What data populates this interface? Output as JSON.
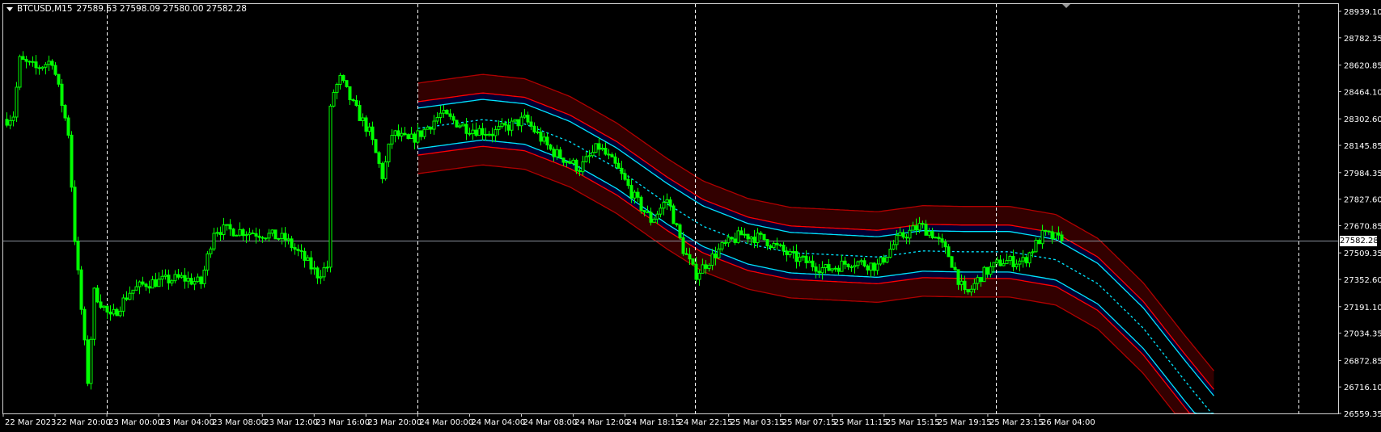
{
  "header": {
    "symbol": "BTCUSD,M15",
    "ohlc": "27589.63 27598.09 27580.00 27582.28",
    "menu_icon": "triangle-down-icon"
  },
  "current_price": "27582.28",
  "colors": {
    "background": "#000000",
    "candle": "#00ff00",
    "band_outer": "#b00000",
    "band_inner_red": "#ff0000",
    "band_fill_red": "#320000",
    "band_fill_navy": "#000033",
    "band_cyan": "#00e5ff",
    "grid_separator": "#ffffff",
    "price_line": "#8a8f9a"
  },
  "chart_data": {
    "type": "candlestick",
    "symbol": "BTCUSD",
    "timeframe": "M15",
    "ylim": [
      26559.35,
      28939.1
    ],
    "grid": false,
    "y_tick_labels": [
      "28939.10",
      "28782.35",
      "28620.85",
      "28464.10",
      "28302.60",
      "28145.85",
      "27984.35",
      "27827.60",
      "27670.85",
      "27509.35",
      "27352.60",
      "27191.10",
      "27034.35",
      "26872.85",
      "26716.10",
      "26559.35"
    ],
    "x_tick_labels": [
      "22 Mar 2023",
      "22 Mar 20:00",
      "23 Mar 00:00",
      "23 Mar 04:00",
      "23 Mar 08:00",
      "23 Mar 12:00",
      "23 Mar 16:00",
      "23 Mar 20:00",
      "24 Mar 00:00",
      "24 Mar 04:00",
      "24 Mar 08:00",
      "24 Mar 12:00",
      "24 Mar 18:15",
      "24 Mar 22:15",
      "25 Mar 03:15",
      "25 Mar 07:15",
      "25 Mar 11:15",
      "25 Mar 15:15",
      "25 Mar 19:15",
      "25 Mar 23:15",
      "26 Mar 04:00"
    ],
    "day_separators": [
      "23 Mar 00:00",
      "24 Mar 00:00",
      "25 Mar 00:00",
      "26 Mar 00:00",
      "27 Mar 00:00"
    ],
    "last_price": 27582.28,
    "price_path": [
      [
        "22 Mar 16:15",
        28300
      ],
      [
        "22 Mar 16:45",
        28325
      ],
      [
        "22 Mar 17:15",
        28650
      ],
      [
        "22 Mar 18:30",
        28600
      ],
      [
        "22 Mar 19:45",
        28650
      ],
      [
        "22 Mar 21:00",
        28220
      ],
      [
        "22 Mar 21:30",
        27590
      ],
      [
        "22 Mar 22:00",
        27170
      ],
      [
        "22 Mar 22:30",
        26750
      ],
      [
        "22 Mar 23:00",
        27280
      ],
      [
        "23 Mar 00:15",
        27120
      ],
      [
        "23 Mar 01:45",
        27280
      ],
      [
        "23 Mar 03:00",
        27330
      ],
      [
        "23 Mar 05:45",
        27360
      ],
      [
        "23 Mar 07:15",
        27330
      ],
      [
        "23 Mar 08:15",
        27650
      ],
      [
        "23 Mar 10:15",
        27640
      ],
      [
        "23 Mar 12:15",
        27620
      ],
      [
        "23 Mar 13:45",
        27590
      ],
      [
        "23 Mar 15:00",
        27490
      ],
      [
        "23 Mar 16:15",
        27380
      ],
      [
        "23 Mar 17:00",
        27430
      ],
      [
        "23 Mar 17:15",
        28430
      ],
      [
        "23 Mar 18:00",
        28540
      ],
      [
        "23 Mar 19:00",
        28380
      ],
      [
        "23 Mar 20:15",
        28220
      ],
      [
        "23 Mar 21:15",
        27960
      ],
      [
        "23 Mar 22:00",
        28220
      ],
      [
        "23 Mar 23:15",
        28170
      ],
      [
        "24 Mar 00:15",
        28220
      ],
      [
        "24 Mar 01:45",
        28330
      ],
      [
        "24 Mar 03:45",
        28250
      ],
      [
        "24 Mar 05:45",
        28220
      ],
      [
        "24 Mar 08:15",
        28300
      ],
      [
        "24 Mar 10:15",
        28115
      ],
      [
        "24 Mar 12:45",
        28010
      ],
      [
        "24 Mar 15:00",
        28140
      ],
      [
        "24 Mar 17:15",
        28010
      ],
      [
        "24 Mar 19:00",
        27830
      ],
      [
        "24 Mar 20:15",
        27700
      ],
      [
        "24 Mar 21:30",
        27830
      ],
      [
        "24 Mar 22:45",
        27540
      ],
      [
        "25 Mar 00:00",
        27380
      ],
      [
        "25 Mar 01:15",
        27460
      ],
      [
        "25 Mar 02:30",
        27540
      ],
      [
        "25 Mar 04:15",
        27620
      ],
      [
        "25 Mar 06:00",
        27590
      ],
      [
        "25 Mar 08:00",
        27490
      ],
      [
        "25 Mar 10:45",
        27410
      ],
      [
        "25 Mar 12:45",
        27460
      ],
      [
        "25 Mar 14:45",
        27430
      ],
      [
        "25 Mar 16:15",
        27590
      ],
      [
        "25 Mar 18:00",
        27670
      ],
      [
        "25 Mar 19:00",
        27620
      ],
      [
        "25 Mar 20:15",
        27490
      ],
      [
        "25 Mar 21:30",
        27250
      ],
      [
        "25 Mar 22:45",
        27380
      ],
      [
        "26 Mar 00:30",
        27460
      ],
      [
        "26 Mar 02:30",
        27460
      ],
      [
        "26 Mar 04:15",
        27620
      ],
      [
        "26 Mar 05:45",
        27582.28
      ]
    ],
    "band": {
      "center": [
        [
          "24 Mar 00:00",
          28246
        ],
        [
          "24 Mar 05:00",
          28298
        ],
        [
          "24 Mar 08:15",
          28272
        ],
        [
          "24 Mar 11:45",
          28167
        ],
        [
          "24 Mar 17:15",
          28010
        ],
        [
          "24 Mar 21:30",
          27800
        ],
        [
          "25 Mar 00:45",
          27668
        ],
        [
          "25 Mar 04:45",
          27563
        ],
        [
          "25 Mar 08:00",
          27511
        ],
        [
          "25 Mar 14:45",
          27485
        ],
        [
          "25 Mar 18:15",
          27521
        ],
        [
          "25 Mar 21:30",
          27516
        ],
        [
          "26 Mar 01:15",
          27516
        ],
        [
          "26 Mar 05:15",
          27469
        ],
        [
          "26 Mar 08:30",
          27327
        ],
        [
          "26 Mar 12:00",
          27065
        ],
        [
          "26 Mar 15:15",
          26750
        ],
        [
          "26 Mar 17:30",
          26540
        ]
      ],
      "inner_cyan_offset": 120,
      "inner_red_offset": 158,
      "outer_red_offset": 268
    }
  }
}
